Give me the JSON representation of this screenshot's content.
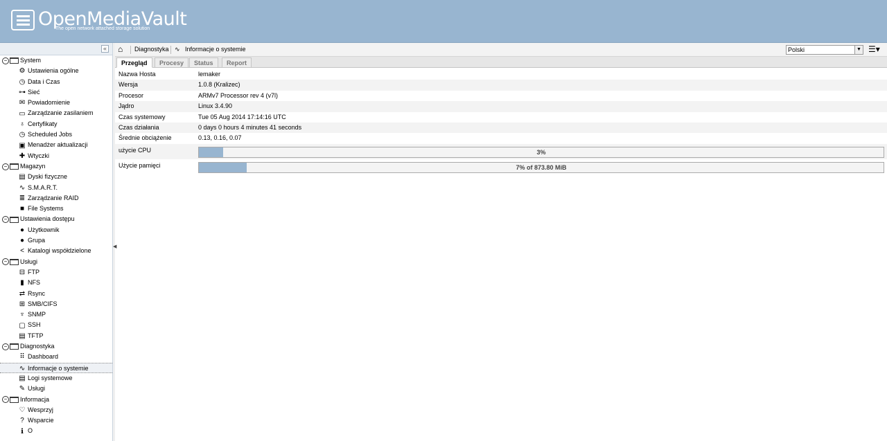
{
  "header": {
    "title": "OpenMediaVault",
    "subtitle": "The open network attached storage solution"
  },
  "breadcrumb": {
    "section": "Diagnostyka",
    "page": "Informacje o systemie"
  },
  "language": {
    "selected": "Polski"
  },
  "tabs": [
    "Przegląd",
    "Procesy",
    "Status",
    "Report"
  ],
  "nav": [
    {
      "label": "System",
      "type": "cat"
    },
    {
      "label": "Ustawienia ogólne",
      "icon": "⚙"
    },
    {
      "label": "Data i Czas",
      "icon": "◷"
    },
    {
      "label": "Sieć",
      "icon": "⊶"
    },
    {
      "label": "Powiadomienie",
      "icon": "✉"
    },
    {
      "label": "Zarządzanie zasilaniem",
      "icon": "▭"
    },
    {
      "label": "Certyfikaty",
      "icon": "♁"
    },
    {
      "label": "Scheduled Jobs",
      "icon": "◷"
    },
    {
      "label": "Menadżer aktualizacji",
      "icon": "▣"
    },
    {
      "label": "Wtyczki",
      "icon": "✚"
    },
    {
      "label": "Magazyn",
      "type": "cat"
    },
    {
      "label": "Dyski fizyczne",
      "icon": "▤"
    },
    {
      "label": "S.M.A.R.T.",
      "icon": "∿"
    },
    {
      "label": "Zarządzanie RAID",
      "icon": "≣"
    },
    {
      "label": "File Systems",
      "icon": "■"
    },
    {
      "label": "Ustawienia dostępu",
      "type": "cat"
    },
    {
      "label": "Użytkownik",
      "icon": "●"
    },
    {
      "label": "Grupa",
      "icon": "●"
    },
    {
      "label": "Katalogi współdzielone",
      "icon": "<"
    },
    {
      "label": "Usługi",
      "type": "cat"
    },
    {
      "label": "FTP",
      "icon": "⊟"
    },
    {
      "label": "NFS",
      "icon": "▮"
    },
    {
      "label": "Rsync",
      "icon": "⇄"
    },
    {
      "label": "SMB/CIFS",
      "icon": "⊞"
    },
    {
      "label": "SNMP",
      "icon": "♆"
    },
    {
      "label": "SSH",
      "icon": "▢"
    },
    {
      "label": "TFTP",
      "icon": "▤"
    },
    {
      "label": "Diagnostyka",
      "type": "cat"
    },
    {
      "label": "Dashboard",
      "icon": "⠿"
    },
    {
      "label": "Informacje o systemie",
      "icon": "∿",
      "selected": true
    },
    {
      "label": "Logi systemowe",
      "icon": "▤"
    },
    {
      "label": "Usługi",
      "icon": "✎"
    },
    {
      "label": "Informacja",
      "type": "cat"
    },
    {
      "label": "Wesprzyj",
      "icon": "♡"
    },
    {
      "label": "Wsparcie",
      "icon": "?"
    },
    {
      "label": "O",
      "icon": "ℹ"
    }
  ],
  "info": [
    {
      "label": "Nazwa Hosta",
      "value": "lemaker"
    },
    {
      "label": "Wersja",
      "value": "1.0.8 (Kralizec)"
    },
    {
      "label": "Procesor",
      "value": "ARMv7 Processor rev 4 (v7l)"
    },
    {
      "label": "Jądro",
      "value": "Linux 3.4.90"
    },
    {
      "label": "Czas systemowy",
      "value": "Tue 05 Aug 2014 17:14:16 UTC"
    },
    {
      "label": "Czas działania",
      "value": "0 days 0 hours 4 minutes 41 seconds"
    },
    {
      "label": "Średnie obciążenie",
      "value": "0.13, 0.16, 0.07"
    }
  ],
  "cpu": {
    "label": "użycie CPU",
    "text": "3%",
    "fraction": 0.035
  },
  "mem": {
    "label": "Użycie pamięci",
    "text": "7% of 873.80 MiB",
    "fraction": 0.07
  }
}
